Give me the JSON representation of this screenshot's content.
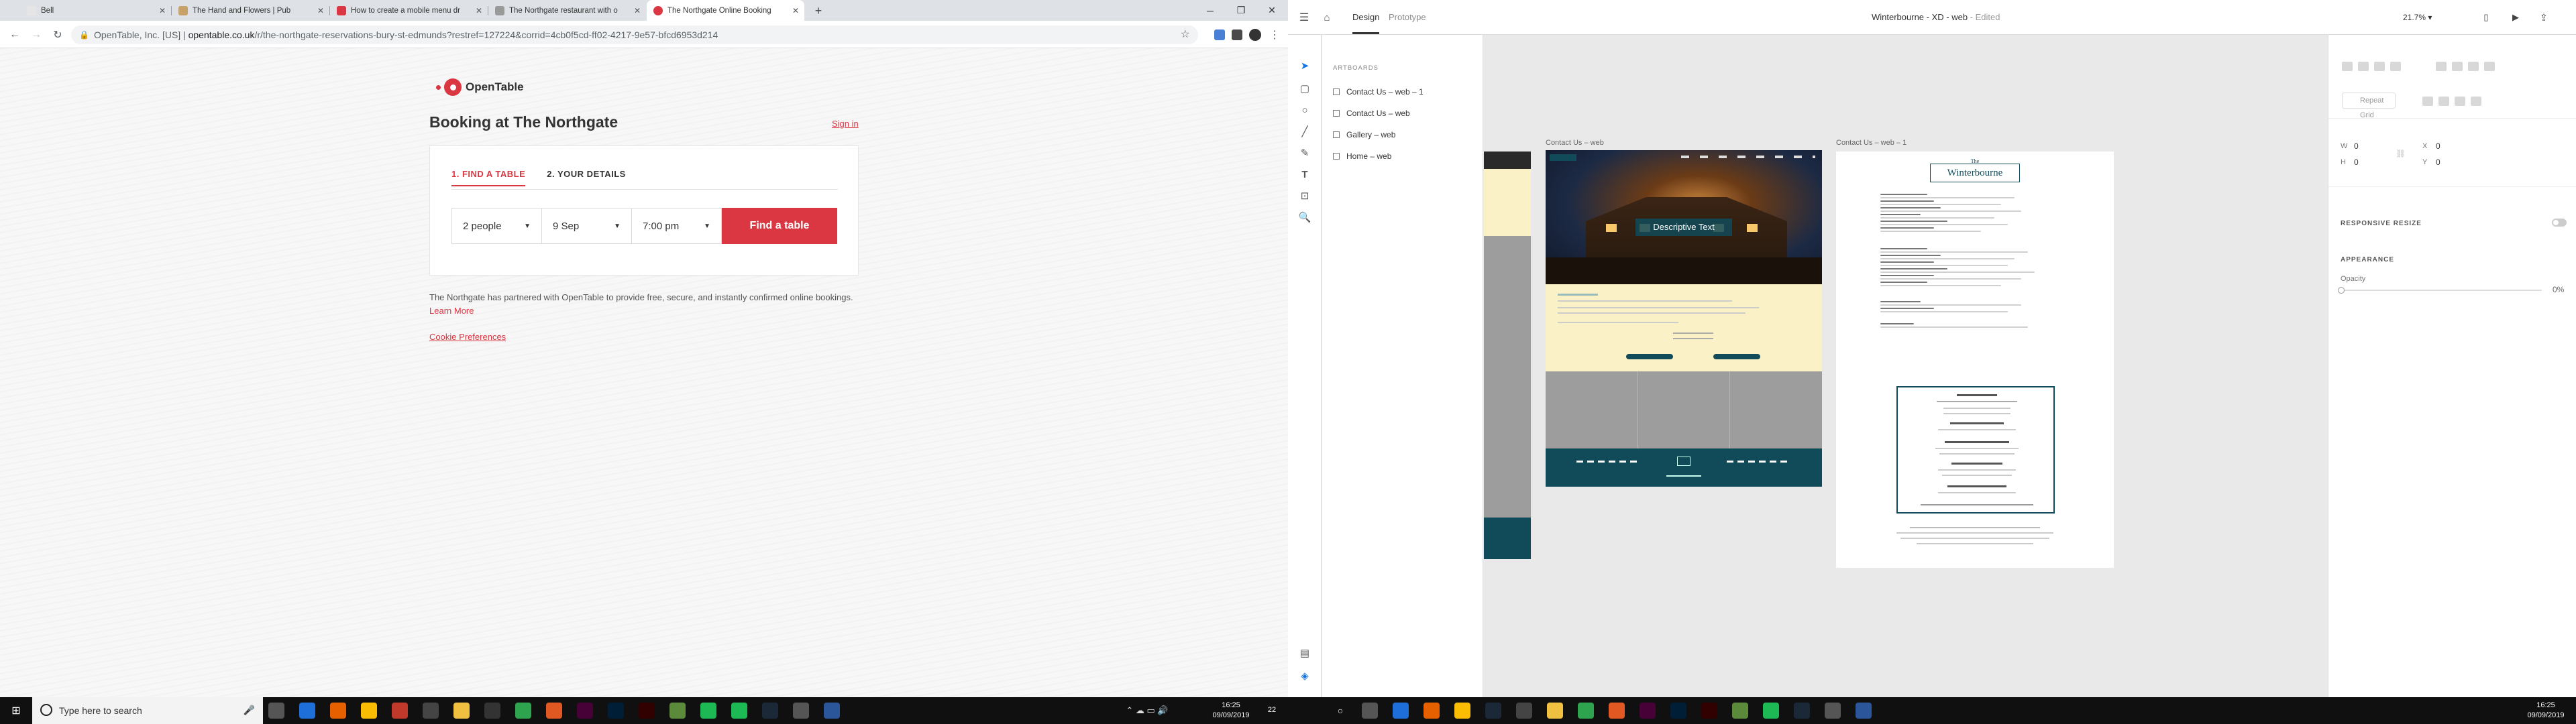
{
  "left": {
    "tabs": [
      {
        "title": "Bell",
        "color": "#e5e5e5"
      },
      {
        "title": "The Hand and Flowers | Pub",
        "color": "#c8a16a"
      },
      {
        "title": "How to create a mobile menu dr",
        "color": "#da3743"
      },
      {
        "title": "The Northgate restaurant with o",
        "color": "#999999"
      },
      {
        "title": "The Northgate Online Booking",
        "color": "#da3743"
      }
    ],
    "new_tab": "+",
    "window_controls": {
      "minimize": "─",
      "maximize": "❐",
      "close": "✕"
    },
    "address": {
      "back": "←",
      "forward": "→",
      "reload": "↻",
      "prefix": "OpenTable, Inc. [US]  |  ",
      "domain": "opentable.co.uk",
      "path": "/r/the-northgate-reservations-bury-st-edmunds?restref=127224&corrid=4cb0f5cd-ff02-4217-9e57-bfcd6953d214",
      "star": "☆"
    },
    "page": {
      "logo_text": "OpenTable",
      "title": "Booking at The Northgate",
      "sign_in": "Sign in",
      "steps": [
        "1. FIND A TABLE",
        "2. YOUR DETAILS"
      ],
      "party_size": "2 people",
      "date": "9 Sep",
      "time": "7:00 pm",
      "find_button": "Find a table",
      "partner_text": "The Northgate has partnered with OpenTable to provide free, secure, and instantly confirmed online bookings.",
      "learn_more": "Learn More",
      "cookie": "Cookie Preferences"
    },
    "taskbar": {
      "search_placeholder": "Type here to search",
      "time": "16:25",
      "date": "09/09/2019",
      "notifications": "22"
    }
  },
  "right": {
    "xd": {
      "nav_design": "Design",
      "nav_prototype": "Prototype",
      "file_title": "Winterbourne - XD - web",
      "edited": " - Edited",
      "zoom": "21.7%",
      "artboards_heading": "ARTBOARDS",
      "artboards": [
        "Contact Us – web – 1",
        "Contact Us – web",
        "Gallery – web",
        "Home – web"
      ],
      "canvas_labels": [
        "Contact Us – web",
        "Contact Us – web – 1"
      ],
      "hero_overlay": "Descriptive Text",
      "menu_brand_small": "The",
      "menu_brand": "Winterbourne",
      "repeat_grid": "Repeat Grid",
      "w_label": "W",
      "w_value": "0",
      "h_label": "H",
      "h_value": "0",
      "x_label": "X",
      "x_value": "0",
      "y_label": "Y",
      "y_value": "0",
      "responsive_resize": "RESPONSIVE RESIZE",
      "appearance": "APPEARANCE",
      "opacity_label": "Opacity",
      "opacity_value": "0%"
    },
    "taskbar": {
      "time": "16:25",
      "date": "09/09/2019"
    }
  }
}
